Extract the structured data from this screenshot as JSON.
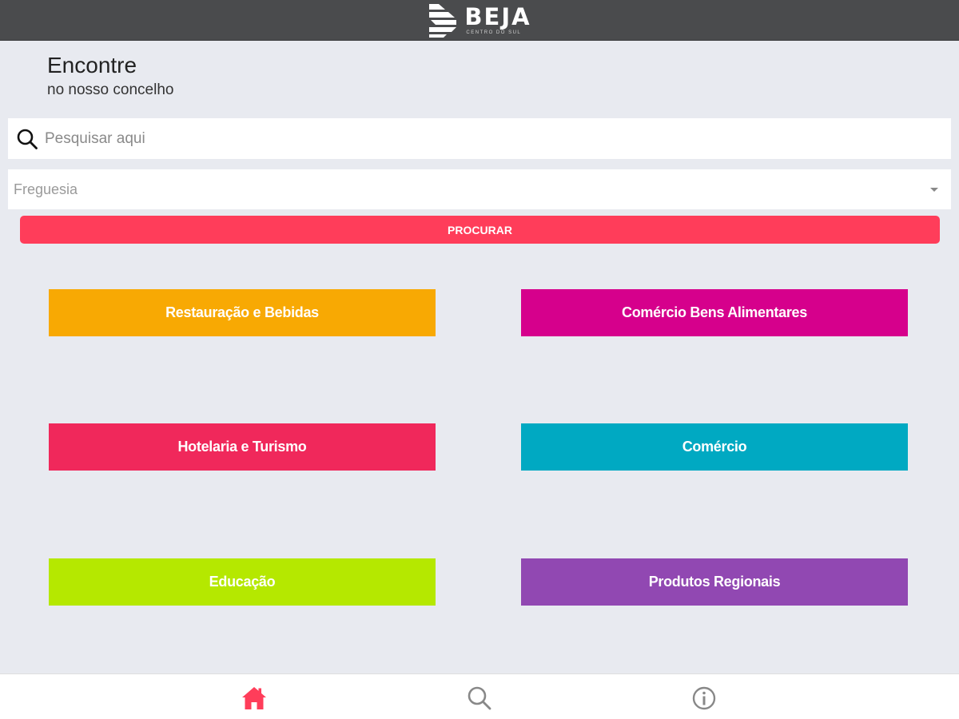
{
  "header": {
    "logo_title": "BEJA",
    "logo_subtitle": "CENTRO DO SUL",
    "background_color": "#4a4b4d"
  },
  "intro": {
    "title": "Encontre",
    "subtitle": "no nosso concelho"
  },
  "search": {
    "icon": "search-icon",
    "placeholder": "Pesquisar aqui",
    "value": ""
  },
  "parish_select": {
    "placeholder": "Freguesia",
    "icon": "chevron-down-icon"
  },
  "search_button": {
    "label": "PROCURAR",
    "color": "#ff3d5a"
  },
  "categories": [
    {
      "label": "Restauração e Bebidas",
      "color": "#f8a903"
    },
    {
      "label": "Comércio Bens Alimentares",
      "color": "#d6008c"
    },
    {
      "label": "Hotelaria e Turismo",
      "color": "#f0285b"
    },
    {
      "label": "Comércio",
      "color": "#00a9c2"
    },
    {
      "label": "Educação",
      "color": "#b5e800"
    },
    {
      "label": "Produtos Regionais",
      "color": "#9148b2"
    }
  ],
  "bottom_nav": {
    "items": [
      {
        "icon": "home-icon",
        "active": true,
        "color": "#ff3d5a"
      },
      {
        "icon": "search-icon",
        "active": false,
        "color": "#888888"
      },
      {
        "icon": "info-icon",
        "active": false,
        "color": "#888888"
      }
    ]
  }
}
